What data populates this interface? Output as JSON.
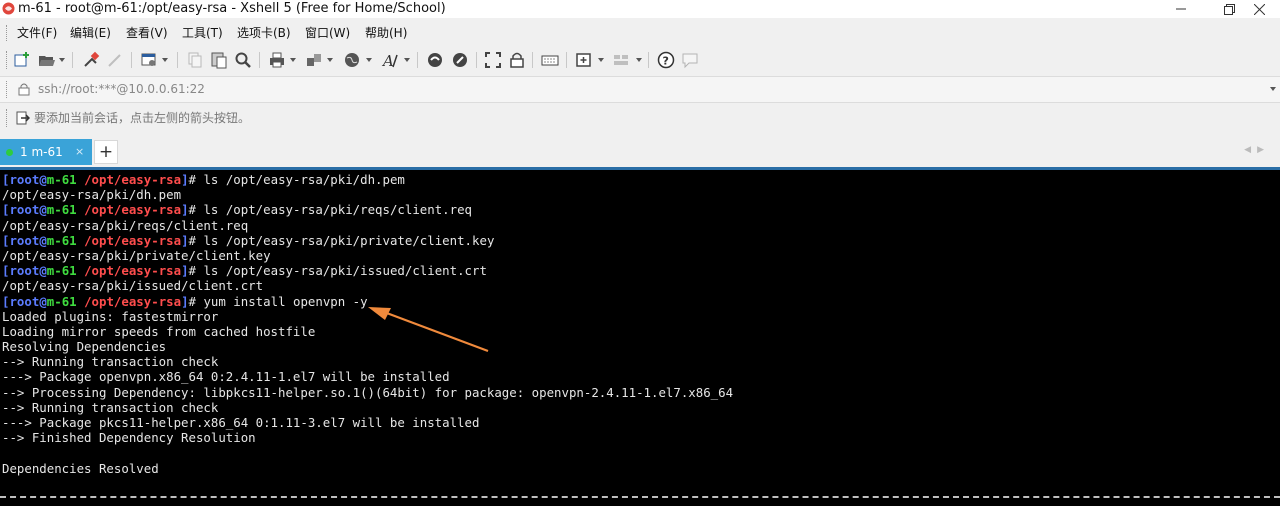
{
  "window": {
    "title": "m-61 - root@m-61:/opt/easy-rsa - Xshell 5 (Free for Home/School)"
  },
  "menu": {
    "items": [
      "文件(F)",
      "编辑(E)",
      "查看(V)",
      "工具(T)",
      "选项卡(B)",
      "窗口(W)",
      "帮助(H)"
    ]
  },
  "address": {
    "value": "ssh://root:***@10.0.0.61:22"
  },
  "hint": {
    "text": "要添加当前会话，点击左侧的箭头按钮。"
  },
  "tabs": [
    {
      "label": "1 m-61",
      "close": "×"
    }
  ],
  "new_tab_label": "+",
  "terminal": {
    "prompt": {
      "user": "root",
      "at": "@",
      "host": "m-61",
      "path": "/opt/easy-rsa",
      "open": "[",
      "close": "]"
    },
    "colors": {
      "background": "#000000",
      "prompt_bracket": "#5b7cff",
      "prompt_host": "#3fdc3f",
      "prompt_path": "#ff4d4d",
      "arrow": "#f08a3c"
    },
    "lines": [
      {
        "cmd": "# ls /opt/easy-rsa/pki/dh.pem"
      },
      {
        "out": "/opt/easy-rsa/pki/dh.pem"
      },
      {
        "cmd": "# ls /opt/easy-rsa/pki/reqs/client.req"
      },
      {
        "out": "/opt/easy-rsa/pki/reqs/client.req"
      },
      {
        "cmd": "# ls /opt/easy-rsa/pki/private/client.key"
      },
      {
        "out": "/opt/easy-rsa/pki/private/client.key"
      },
      {
        "cmd": "# ls /opt/easy-rsa/pki/issued/client.crt"
      },
      {
        "out": "/opt/easy-rsa/pki/issued/client.crt"
      },
      {
        "cmd": "# yum install openvpn -y"
      },
      {
        "out": "Loaded plugins: fastestmirror"
      },
      {
        "out": "Loading mirror speeds from cached hostfile"
      },
      {
        "out": "Resolving Dependencies"
      },
      {
        "out": "--> Running transaction check"
      },
      {
        "out": "---> Package openvpn.x86_64 0:2.4.11-1.el7 will be installed"
      },
      {
        "out": "--> Processing Dependency: libpkcs11-helper.so.1()(64bit) for package: openvpn-2.4.11-1.el7.x86_64"
      },
      {
        "out": "--> Running transaction check"
      },
      {
        "out": "---> Package pkcs11-helper.x86_64 0:1.11-3.el7 will be installed"
      },
      {
        "out": "--> Finished Dependency Resolution"
      },
      {
        "out": ""
      },
      {
        "out": "Dependencies Resolved"
      }
    ]
  },
  "toolbar_icons": [
    "new-session-icon",
    "open-folder-icon",
    "reconnect-icon",
    "disconnect-icon",
    "properties-icon",
    "copy-icon",
    "paste-icon",
    "find-icon",
    "print-icon",
    "transfer-icon",
    "globe-icon",
    "font-icon",
    "script-icon",
    "compose-icon",
    "fullscreen-icon",
    "lock-icon",
    "keyboard-icon",
    "add-tab-icon",
    "layout-icon",
    "help-icon",
    "chat-icon"
  ]
}
